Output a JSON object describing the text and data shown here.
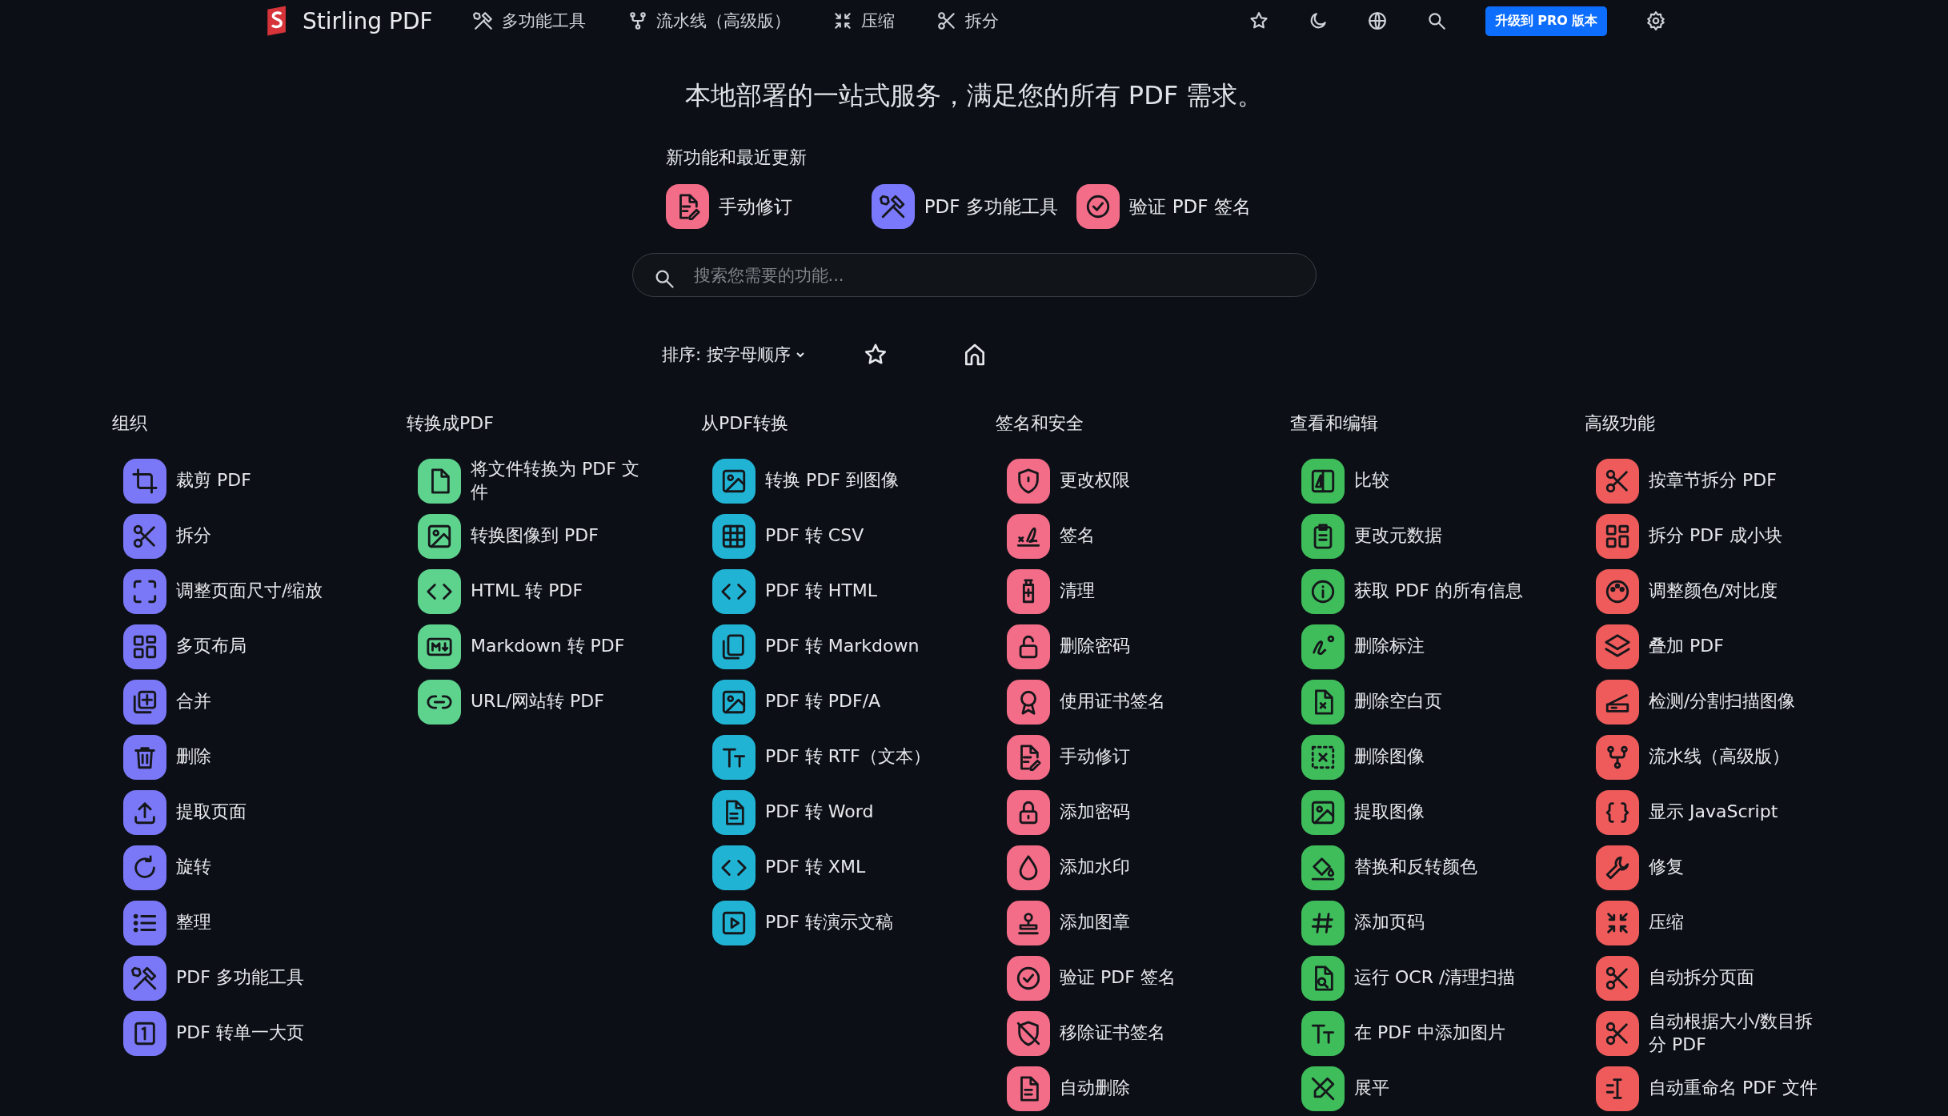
{
  "nav": {
    "brand": "Stirling PDF",
    "items": [
      "多功能工具",
      "流水线（高级版）",
      "压缩",
      "拆分"
    ],
    "upgrade_button": "升级到 PRO 版本"
  },
  "headline": "本地部署的一站式服务，满足您的所有 PDF 需求。",
  "news": {
    "title": "新功能和最近更新",
    "items": [
      {
        "label": "手动修订",
        "color": "#f46d88"
      },
      {
        "label": "PDF 多功能工具",
        "color": "#7a78fb"
      },
      {
        "label": "验证 PDF 签名",
        "color": "#f46d88"
      }
    ]
  },
  "search": {
    "placeholder": "搜索您需要的功能..."
  },
  "sort": {
    "label": "排序: 按字母顺序"
  },
  "categories": [
    {
      "title": "组织",
      "color": "#7b78f8",
      "items": [
        "裁剪 PDF",
        "拆分",
        "调整页面尺寸/缩放",
        "多页布局",
        "合并",
        "删除",
        "提取页面",
        "旋转",
        "整理",
        "PDF 多功能工具",
        "PDF 转单一大页"
      ]
    },
    {
      "title": "转换成PDF",
      "color": "#5ed38e",
      "items": [
        "将文件转换为 PDF 文件",
        "转换图像到 PDF",
        "HTML 转 PDF",
        "Markdown 转 PDF",
        "URL/网站转 PDF"
      ]
    },
    {
      "title": "从PDF转换",
      "color": "#21b3d4",
      "items": [
        "转换 PDF 到图像",
        "PDF 转 CSV",
        "PDF 转 HTML",
        "PDF 转 Markdown",
        "PDF 转 PDF/A",
        "PDF 转 RTF（文本）",
        "PDF 转 Word",
        "PDF 转 XML",
        "PDF 转演示文稿"
      ]
    },
    {
      "title": "签名和安全",
      "color": "#f46d88",
      "items": [
        "更改权限",
        "签名",
        "清理",
        "删除密码",
        "使用证书签名",
        "手动修订",
        "添加密码",
        "添加水印",
        "添加图章",
        "验证 PDF 签名",
        "移除证书签名",
        "自动删除"
      ]
    },
    {
      "title": "查看和编辑",
      "color": "#3fbd5b",
      "items": [
        "比较",
        "更改元数据",
        "获取 PDF 的所有信息",
        "删除标注",
        "删除空白页",
        "删除图像",
        "提取图像",
        "替换和反转颜色",
        "添加页码",
        "运行 OCR /清理扫描",
        "在 PDF 中添加图片",
        "展平"
      ]
    },
    {
      "title": "高级功能",
      "color": "#ef5b5b",
      "items": [
        "按章节拆分 PDF",
        "拆分 PDF 成小块",
        "调整颜色/对比度",
        "叠加 PDF",
        "检测/分割扫描图像",
        "流水线（高级版）",
        "显示 JavaScript",
        "修复",
        "压缩",
        "自动拆分页面",
        "自动根据大小/数目拆分 PDF",
        "自动重命名 PDF 文件"
      ]
    }
  ]
}
